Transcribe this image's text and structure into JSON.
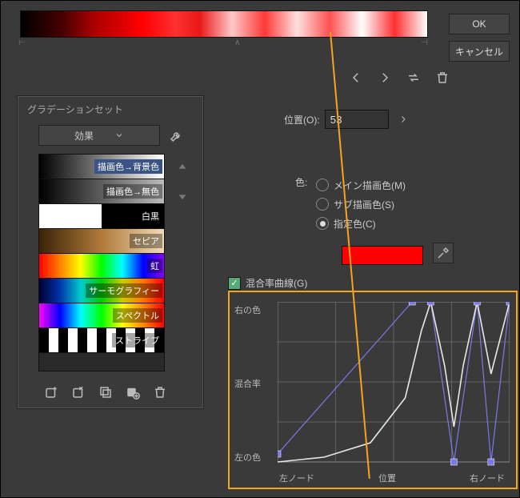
{
  "buttons": {
    "ok": "OK",
    "cancel": "キャンセル"
  },
  "set_panel": {
    "title": "グラデーションセット",
    "dropdown": "効果",
    "items": [
      {
        "label": "描画色→背景色",
        "selected": true,
        "gradient": "linear-gradient(90deg,#000,#fff)"
      },
      {
        "label": "描画色→無色",
        "gradient": "linear-gradient(90deg,#000,#bbb)"
      },
      {
        "label": "白黒",
        "gradient": "linear-gradient(90deg,#fff 0%,#fff 50%,#000 50%,#000 100%)"
      },
      {
        "label": "セピア",
        "gradient": "linear-gradient(90deg,#3b2208,#b07a3a,#f1dbb5)"
      },
      {
        "label": "虹",
        "gradient": "linear-gradient(90deg,#f00,#ff8000,#ff0,#0f0,#0ff,#00f,#80f)"
      },
      {
        "label": "サーモグラフィー",
        "gradient": "linear-gradient(90deg,#003,#03a,#0cc,#0c0,#cc0,#f70,#f00)"
      },
      {
        "label": "スペクトル",
        "gradient": "linear-gradient(90deg,#f0f,#00f,#0ff,#0f0,#ff0,#f80,#f00)"
      },
      {
        "label": "ストライプ",
        "gradient": "repeating-linear-gradient(90deg,#000 0 12px,#fff 12px 24px)"
      }
    ]
  },
  "position": {
    "label": "位置(O):",
    "value": "53"
  },
  "color": {
    "label": "色:",
    "opt_main": "メイン描画色(M)",
    "opt_sub": "サブ描画色(S)",
    "opt_spec": "指定色(C)",
    "swatch": "#ff0000"
  },
  "curve_check": "混合率曲線(G)",
  "curve": {
    "ylab_top": "右の色",
    "ylab_mid": "混合率",
    "ylab_bot": "左の色",
    "xlab_left": "左ノード",
    "xlab_mid": "位置",
    "xlab_right": "右ノード"
  },
  "chart_data": {
    "type": "line",
    "title": "混合率曲線",
    "xlabel": "位置",
    "ylabel": "混合率",
    "xlim": [
      0,
      100
    ],
    "ylim": [
      0,
      100
    ],
    "curve_points": [
      [
        0,
        0
      ],
      [
        20,
        3
      ],
      [
        40,
        12
      ],
      [
        55,
        40
      ],
      [
        62,
        82
      ],
      [
        66,
        100
      ],
      [
        72,
        60
      ],
      [
        76,
        22
      ],
      [
        80,
        60
      ],
      [
        86,
        100
      ],
      [
        92,
        55
      ],
      [
        100,
        100
      ]
    ],
    "control_handles": [
      [
        0,
        5
      ],
      [
        58,
        100
      ],
      [
        66,
        100
      ],
      [
        76,
        0
      ],
      [
        86,
        100
      ],
      [
        92,
        0
      ],
      [
        100,
        100
      ]
    ]
  }
}
